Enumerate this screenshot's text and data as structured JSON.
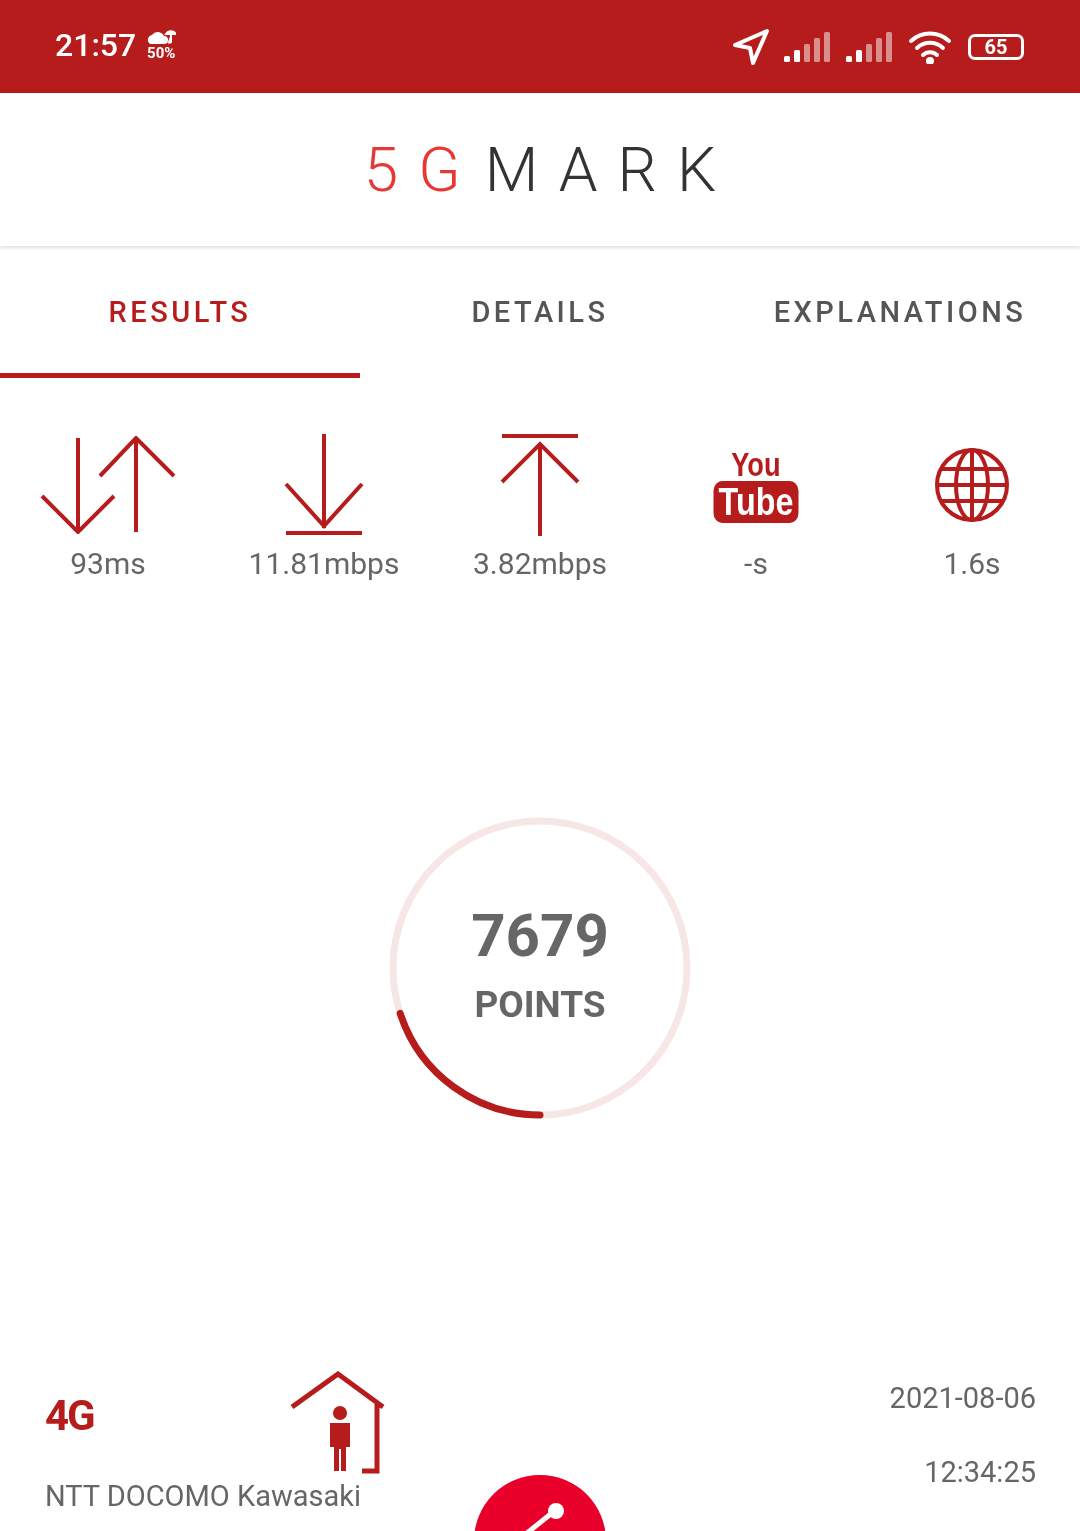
{
  "status_bar": {
    "time": "21:57",
    "weather": "50%",
    "battery": "65"
  },
  "logo": {
    "accent": "5G",
    "rest": "MARK"
  },
  "tabs": [
    {
      "label": "RESULTS",
      "selected": true
    },
    {
      "label": "DETAILS",
      "selected": false
    },
    {
      "label": "EXPLANATIONS",
      "selected": false
    }
  ],
  "metrics": [
    {
      "kind": "latency",
      "value": "93ms"
    },
    {
      "kind": "download",
      "value": "11.81mbps"
    },
    {
      "kind": "upload",
      "value": "3.82mbps"
    },
    {
      "kind": "video",
      "logo_top": "You",
      "logo_bottom": "Tube",
      "value": "-s"
    },
    {
      "kind": "web",
      "value": "1.6s"
    }
  ],
  "score": {
    "value": "7679",
    "unit": "POINTS",
    "level": 0.2
  },
  "network": {
    "technology": "4G",
    "operator": "NTT DOCOMO",
    "location": "Kawasaki",
    "date": "2021-08-06",
    "time": "12:34:25"
  }
}
